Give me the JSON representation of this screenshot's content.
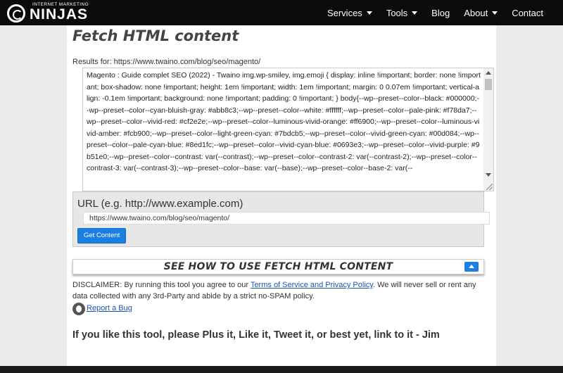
{
  "header": {
    "logo_tagline": "INTERNET MARKETING",
    "logo_brand": "NINJAS",
    "nav": [
      {
        "label": "Services",
        "dropdown": true
      },
      {
        "label": "Tools",
        "dropdown": true
      },
      {
        "label": "Blog",
        "dropdown": false
      },
      {
        "label": "About",
        "dropdown": true
      },
      {
        "label": "Contact",
        "dropdown": false
      }
    ]
  },
  "main": {
    "title": "Fetch HTML content",
    "results_label": "Results for: https://www.twaino.com/blog/seo/magento/",
    "results_text": " Magento : Guide complet SEO (2022) - Twaino img.wp-smiley, img.emoji { display: inline !important; border: none !important; box-shadow: none !important; height: 1em !important; width: 1em !important; margin: 0 0.07em !important; vertical-align: -0.1em !important; background: none !important; padding: 0 !important; } body{--wp--preset--color--black: #000000;--wp--preset--color--cyan-bluish-gray: #abb8c3;--wp--preset--color--white: #ffffff;--wp--preset--color--pale-pink: #f78da7;--wp--preset--color--vivid-red: #cf2e2e;--wp--preset--color--luminous-vivid-orange: #ff6900;--wp--preset--color--luminous-vivid-amber: #fcb900;--wp--preset--color--light-green-cyan: #7bdcb5;--wp--preset--color--vivid-green-cyan: #00d084;--wp--preset--color--pale-cyan-blue: #8ed1fc;--wp--preset--color--vivid-cyan-blue: #0693e3;--wp--preset--color--vivid-purple: #9b51e0;--wp--preset--color--contrast: var(--contrast);--wp--preset--color--contrast-2: var(--contrast-2);--wp--preset--color--contrast-3: var(--contrast-3);--wp--preset--color--base: var(--base);--wp--preset--color--base-2: var(--",
    "form": {
      "url_label": "URL (e.g. http://www.example.com)",
      "url_value": "https://www.twaino.com/blog/seo/magento/",
      "button_label": "Get Content"
    },
    "howto_label": "SEE HOW TO USE FETCH HTML CONTENT",
    "disclaimer": {
      "before": "DISCLAIMER: By running this tool you agree to our ",
      "link": "Terms of Service and Privacy Policy",
      "after": ". We will never sell or rent any data collected with any 3rd-Party and abide by a strict no-SPAM policy."
    },
    "bug_link": "Report a Bug",
    "plus_line": "If you like this tool, please Plus it, Like it, Tweet it, or best yet, link to it - Jim"
  },
  "colors": {
    "nav_bg": "#0b0b0b",
    "accent": "#1a7fe0",
    "page_bg": "#ebebeb"
  }
}
